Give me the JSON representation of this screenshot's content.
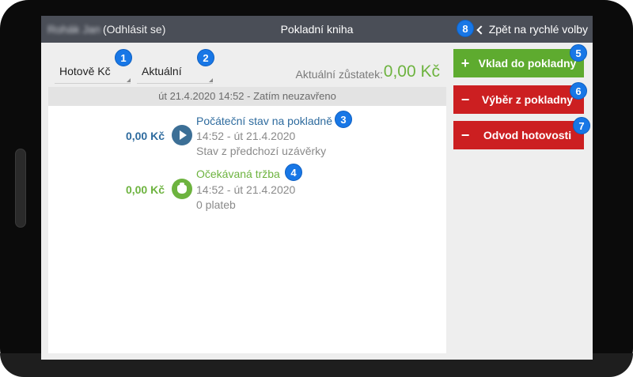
{
  "header": {
    "user_name": "Rohák Jan",
    "logout_label": "(Odhlásit se)",
    "title": "Pokladní kniha",
    "back_label": "Zpět na rychlé volby"
  },
  "filters": {
    "currency": "Hotově Kč",
    "period": "Aktuální"
  },
  "balance": {
    "label": "Aktuální zůstatek:",
    "value": "0,00 Kč"
  },
  "session_line": "út 21.4.2020 14:52 - Zatím neuzavřeno",
  "entries": [
    {
      "amount": "0,00 Kč",
      "title": "Počáteční stav na pokladně",
      "time": "14:52 - út 21.4.2020",
      "note": "Stav z předchozí uzávěrky"
    },
    {
      "amount": "0,00 Kč",
      "title": "Očekávaná tržba",
      "time": "14:52 - út 21.4.2020",
      "note": "0 plateb"
    }
  ],
  "actions": {
    "deposit": {
      "symbol": "+",
      "label": "Vklad do pokladny"
    },
    "withdraw": {
      "symbol": "−",
      "label": "Výběr z pokladny"
    },
    "transfer": {
      "symbol": "−",
      "label": "Odvod hotovosti"
    }
  },
  "badges": [
    "1",
    "2",
    "3",
    "4",
    "5",
    "6",
    "7",
    "8"
  ],
  "colors": {
    "header_bg": "#4a4e57",
    "accent_green": "#6db33f",
    "accent_blue": "#2e6b9e",
    "danger_red": "#cc1f21",
    "badge_blue": "#1877e6"
  }
}
